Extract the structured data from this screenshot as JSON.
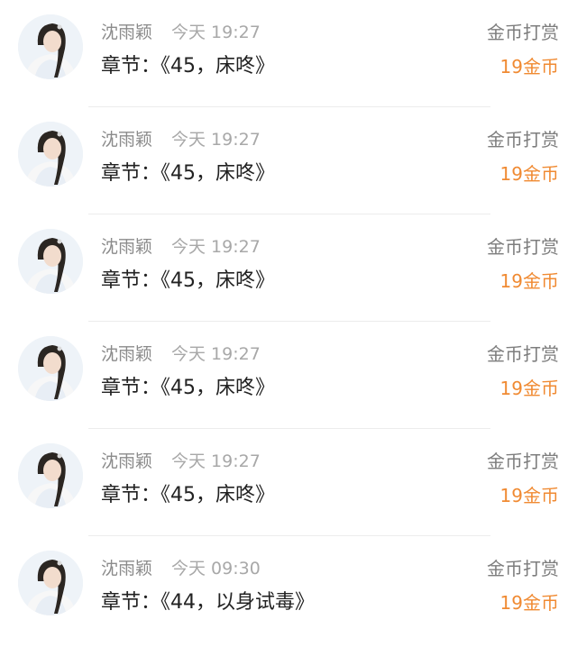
{
  "colors": {
    "name_gray": "#8b8b8b",
    "time_gray": "#a8a8a8",
    "action_gray": "#7d7d7d",
    "amount_orange": "#f08a32",
    "divider": "#ececec"
  },
  "records": [
    {
      "avatar": "user-avatar-photo",
      "name": "沈雨颖",
      "time": "今天 19:27",
      "action": "金币打赏",
      "chapter": "章节：《45，床咚》",
      "amount": "19金币"
    },
    {
      "avatar": "user-avatar-photo",
      "name": "沈雨颖",
      "time": "今天 19:27",
      "action": "金币打赏",
      "chapter": "章节：《45，床咚》",
      "amount": "19金币"
    },
    {
      "avatar": "user-avatar-photo",
      "name": "沈雨颖",
      "time": "今天 19:27",
      "action": "金币打赏",
      "chapter": "章节：《45，床咚》",
      "amount": "19金币"
    },
    {
      "avatar": "user-avatar-photo",
      "name": "沈雨颖",
      "time": "今天 19:27",
      "action": "金币打赏",
      "chapter": "章节：《45，床咚》",
      "amount": "19金币"
    },
    {
      "avatar": "user-avatar-photo",
      "name": "沈雨颖",
      "time": "今天 19:27",
      "action": "金币打赏",
      "chapter": "章节：《45，床咚》",
      "amount": "19金币"
    },
    {
      "avatar": "user-avatar-photo",
      "name": "沈雨颖",
      "time": "今天 09:30",
      "action": "金币打赏",
      "chapter": "章节：《44，以身试毒》",
      "amount": "19金币"
    }
  ]
}
